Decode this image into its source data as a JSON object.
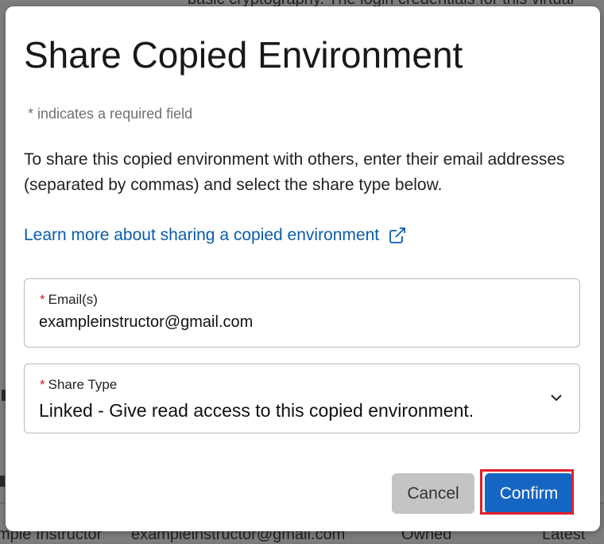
{
  "background": {
    "top_text": "basic cryptography. The login credentials for this virtual",
    "row_name": "mple Instructor",
    "row_email": "exampleinstructor@gmail.com",
    "row_status": "Owned",
    "row_date": "Latest"
  },
  "dialog": {
    "title": "Share Copied Environment",
    "required_note": "* indicates a required field",
    "description": "To share this copied environment with others, enter their email addresses (separated by commas) and select the share type below.",
    "learn_more": "Learn more about sharing a copied environment",
    "email": {
      "label": "Email(s)",
      "value": "exampleinstructor@gmail.com"
    },
    "share_type": {
      "label": "Share Type",
      "value": "Linked - Give read access to this copied environment."
    },
    "cancel_label": "Cancel",
    "confirm_label": "Confirm"
  },
  "colors": {
    "link": "#0b5cad",
    "required_star": "#c8232c",
    "confirm_bg": "#1566c2",
    "highlight": "#e01e2a"
  },
  "icons": [
    "external-link-icon",
    "chevron-down-icon"
  ]
}
